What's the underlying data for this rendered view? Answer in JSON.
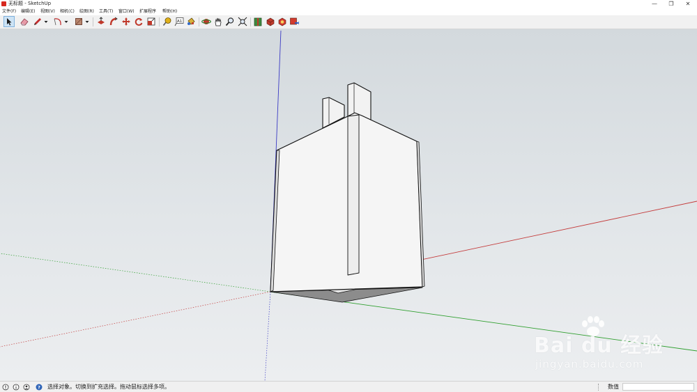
{
  "window": {
    "title": "无标题 - SketchUp",
    "buttons": {
      "minimize": "—",
      "maximize": "❐",
      "close": "✕"
    }
  },
  "menu": {
    "items": [
      {
        "label": "文件(F)"
      },
      {
        "label": "编辑(E)"
      },
      {
        "label": "视图(V)"
      },
      {
        "label": "相机(C)"
      },
      {
        "label": "绘图(R)"
      },
      {
        "label": "工具(T)"
      },
      {
        "label": "窗口(W)"
      },
      {
        "label": "扩展程序"
      },
      {
        "label": "帮助(H)"
      }
    ]
  },
  "toolbar": {
    "tools": [
      {
        "name": "select-tool",
        "icon": "arrow-icon",
        "active": true
      },
      {
        "name": "eraser-tool",
        "icon": "eraser-icon"
      },
      {
        "name": "line-tool",
        "icon": "pencil-icon",
        "dropdown": true
      },
      {
        "name": "arc-tool",
        "icon": "arc-icon",
        "dropdown": true
      },
      {
        "name": "rectangle-tool",
        "icon": "rectangle-icon",
        "dropdown": true
      },
      {
        "name": "push-pull-tool",
        "icon": "push-pull-icon"
      },
      {
        "name": "follow-me-tool",
        "icon": "follow-me-icon"
      },
      {
        "name": "move-tool",
        "icon": "move-icon"
      },
      {
        "name": "rotate-tool",
        "icon": "rotate-icon"
      },
      {
        "name": "scale-tool",
        "icon": "scale-icon"
      },
      {
        "name": "tape-measure-tool",
        "icon": "tape-measure-icon"
      },
      {
        "name": "text-tool",
        "icon": "text-icon",
        "glyph": "A1"
      },
      {
        "name": "paint-bucket-tool",
        "icon": "paint-bucket-icon"
      },
      {
        "name": "orbit-tool",
        "icon": "orbit-icon"
      },
      {
        "name": "pan-tool",
        "icon": "hand-icon"
      },
      {
        "name": "zoom-tool",
        "icon": "zoom-icon"
      },
      {
        "name": "zoom-extents-tool",
        "icon": "zoom-extents-icon"
      },
      {
        "name": "warehouse-tool",
        "icon": "warehouse-icon"
      },
      {
        "name": "extension-warehouse-tool",
        "icon": "extension-warehouse-icon"
      },
      {
        "name": "layout-tool",
        "icon": "layout-icon"
      },
      {
        "name": "send-to-layout-tool",
        "icon": "send-to-layout-icon"
      }
    ]
  },
  "watermark": {
    "brand": "Bai du 经验",
    "url": "jingyan.baidu.com"
  },
  "status": {
    "message": "选择对象。切换到扩充选择。拖动鼠标选择多项。",
    "measurements_label": "数值",
    "measurements_value": ""
  },
  "colors": {
    "axis_red": "#c43a3a",
    "axis_green": "#2e9f2e",
    "axis_blue": "#3a3ac4",
    "model_face": "#f4f4f4",
    "model_bottom": "#8c8c8c",
    "sky_top": "#d3d9dd",
    "ground": "#eceef0"
  }
}
